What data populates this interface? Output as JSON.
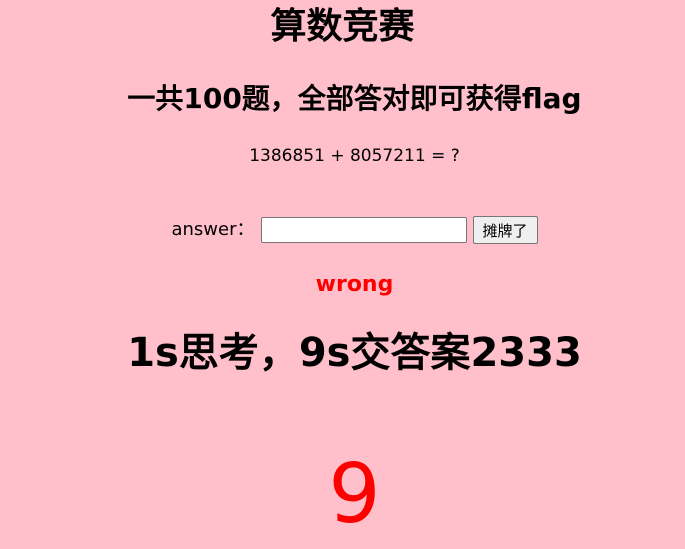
{
  "page": {
    "title": "算数竞赛",
    "subtitle": "一共100题，全部答对即可获得flag",
    "question": "1386851 + 8057211 = ?",
    "answer_label": "answer：",
    "answer_value": "",
    "answer_placeholder": "",
    "submit_label": "摊牌了",
    "status": "wrong",
    "hint": "1s思考，9s交答案2333",
    "countdown": "9"
  },
  "colors": {
    "background": "#ffc0cb",
    "status": "#ff0000",
    "countdown": "#ff0000"
  }
}
